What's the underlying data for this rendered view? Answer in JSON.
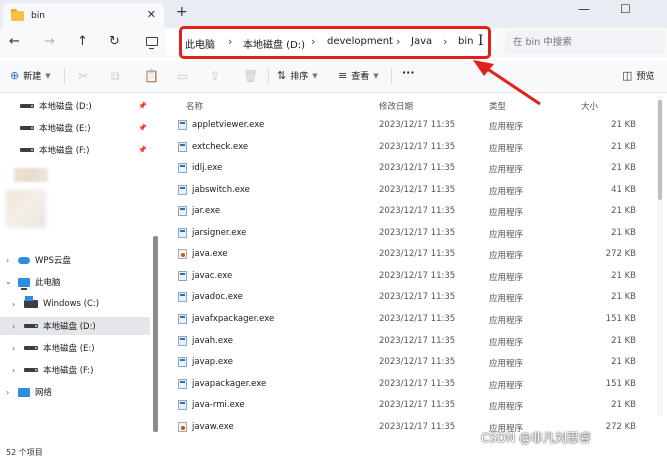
{
  "window": {
    "tab_title": "bin",
    "tab_close": "✕",
    "new_tab": "+",
    "minimize": "—",
    "maximize": "☐"
  },
  "nav": {
    "back": "←",
    "forward": "→",
    "up": "↑",
    "refresh": "↻"
  },
  "breadcrumb": [
    "此电脑",
    "本地磁盘 (D:)",
    "development",
    "Java",
    "bin"
  ],
  "breadcrumb_separator": "›",
  "search": {
    "placeholder": "在 bin 中搜索"
  },
  "toolbar": {
    "new_label": "新建",
    "sort_label": "排序",
    "view_label": "查看",
    "more_label": "···",
    "details_label": "预览"
  },
  "sidebar": {
    "pinned": [
      {
        "label": "本地磁盘 (D:)"
      },
      {
        "label": "本地磁盘 (E:)"
      },
      {
        "label": "本地磁盘 (F:)"
      }
    ],
    "wps": "WPS云盘",
    "this_pc": "此电脑",
    "drives": [
      {
        "label": "Windows (C:)"
      },
      {
        "label": "本地磁盘 (D:)",
        "selected": true
      },
      {
        "label": "本地磁盘 (E:)"
      },
      {
        "label": "本地磁盘 (F:)"
      }
    ],
    "network": "网络"
  },
  "columns": {
    "name": "名称",
    "modified": "修改日期",
    "type": "类型",
    "size": "大小"
  },
  "files": [
    {
      "name": "appletviewer.exe",
      "modified": "2023/12/17 11:35",
      "type": "应用程序",
      "size": "21 KB",
      "icon": "exe"
    },
    {
      "name": "extcheck.exe",
      "modified": "2023/12/17 11:35",
      "type": "应用程序",
      "size": "21 KB",
      "icon": "exe"
    },
    {
      "name": "idlj.exe",
      "modified": "2023/12/17 11:35",
      "type": "应用程序",
      "size": "21 KB",
      "icon": "exe"
    },
    {
      "name": "jabswitch.exe",
      "modified": "2023/12/17 11:35",
      "type": "应用程序",
      "size": "41 KB",
      "icon": "exe"
    },
    {
      "name": "jar.exe",
      "modified": "2023/12/17 11:35",
      "type": "应用程序",
      "size": "21 KB",
      "icon": "exe"
    },
    {
      "name": "jarsigner.exe",
      "modified": "2023/12/17 11:35",
      "type": "应用程序",
      "size": "21 KB",
      "icon": "exe"
    },
    {
      "name": "java.exe",
      "modified": "2023/12/17 11:35",
      "type": "应用程序",
      "size": "272 KB",
      "icon": "java"
    },
    {
      "name": "javac.exe",
      "modified": "2023/12/17 11:35",
      "type": "应用程序",
      "size": "21 KB",
      "icon": "exe"
    },
    {
      "name": "javadoc.exe",
      "modified": "2023/12/17 11:35",
      "type": "应用程序",
      "size": "21 KB",
      "icon": "exe"
    },
    {
      "name": "javafxpackager.exe",
      "modified": "2023/12/17 11:35",
      "type": "应用程序",
      "size": "151 KB",
      "icon": "exe"
    },
    {
      "name": "javah.exe",
      "modified": "2023/12/17 11:35",
      "type": "应用程序",
      "size": "21 KB",
      "icon": "exe"
    },
    {
      "name": "javap.exe",
      "modified": "2023/12/17 11:35",
      "type": "应用程序",
      "size": "21 KB",
      "icon": "exe"
    },
    {
      "name": "javapackager.exe",
      "modified": "2023/12/17 11:35",
      "type": "应用程序",
      "size": "151 KB",
      "icon": "exe"
    },
    {
      "name": "java-rmi.exe",
      "modified": "2023/12/17 11:35",
      "type": "应用程序",
      "size": "21 KB",
      "icon": "exe"
    },
    {
      "name": "javaw.exe",
      "modified": "2023/12/17 11:35",
      "type": "应用程序",
      "size": "272 KB",
      "icon": "java"
    }
  ],
  "status": {
    "item_count": "52 个项目"
  },
  "watermark": "CSDN @非凡刘思睿",
  "colors": {
    "highlight_box": "#e0211b",
    "accent": "#2b6fcc"
  }
}
